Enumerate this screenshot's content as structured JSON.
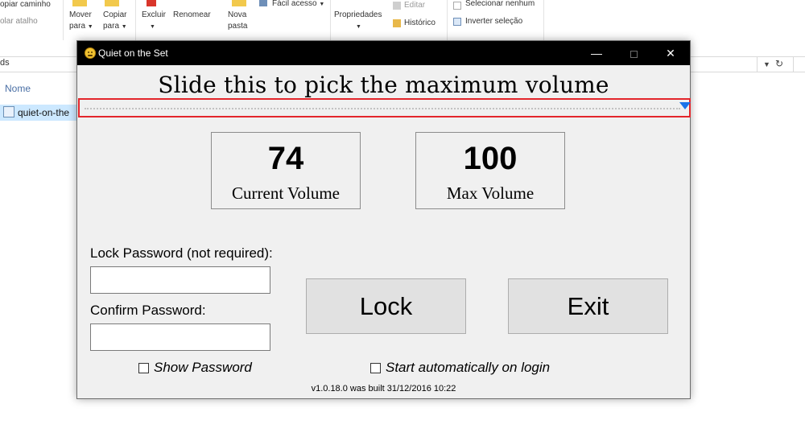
{
  "explorer": {
    "ribbon": {
      "copy_path": "opiar caminho",
      "paste_shortcut": "olar atalho",
      "move_to": [
        "Mover",
        "para"
      ],
      "copy_to": [
        "Copiar",
        "para"
      ],
      "delete": "Excluir",
      "rename": "Renomear",
      "new_folder": [
        "Nova",
        "pasta"
      ],
      "easy_access": "Fácil acesso",
      "properties": "Propriedades",
      "edit": "Editar",
      "history": "Histórico",
      "select_none": "Selecionar nenhum",
      "invert_selection": "Inverter seleção"
    },
    "address_text": "ds",
    "column_name": "Nome",
    "file_name": "quiet-on-the"
  },
  "app": {
    "title": "Quiet on the Set",
    "slider_heading": "Slide this to pick the maximum volume",
    "max_volume_level": 100,
    "current_volume": {
      "value": "74",
      "label": "Current Volume"
    },
    "max_volume": {
      "value": "100",
      "label": "Max Volume"
    },
    "lock_password_label": "Lock Password (not required):",
    "lock_password_value": "",
    "confirm_password_label": "Confirm Password:",
    "confirm_password_value": "",
    "lock_button": "Lock",
    "exit_button": "Exit",
    "show_password": {
      "label": "Show Password",
      "checked": false
    },
    "start_auto": {
      "label": "Start automatically on login",
      "checked": false
    },
    "version": "v1.0.18.0 was built 31/12/2016 10:22"
  },
  "colors": {
    "slider_thumb": "#1a73e8",
    "highlight_border": "#e3262b",
    "titlebar": "#000000"
  },
  "icons": [
    "app-emoji-icon",
    "minimize-icon",
    "maximize-icon",
    "close-icon",
    "chevron-down-icon",
    "refresh-icon",
    "file-icon"
  ]
}
